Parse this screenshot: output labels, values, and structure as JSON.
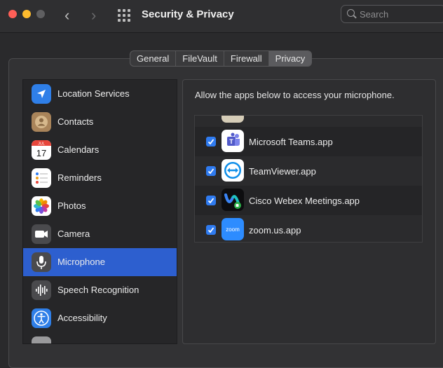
{
  "window": {
    "title": "Security & Privacy"
  },
  "search": {
    "placeholder": "Search"
  },
  "tabs": [
    {
      "label": "General"
    },
    {
      "label": "FileVault"
    },
    {
      "label": "Firewall"
    },
    {
      "label": "Privacy",
      "active": true
    }
  ],
  "sidebar": {
    "items": [
      {
        "label": "Location Services",
        "icon": "location-arrow-icon"
      },
      {
        "label": "Contacts",
        "icon": "contacts-icon"
      },
      {
        "label": "Calendars",
        "icon": "calendar-icon",
        "icon_month": "JUL",
        "icon_day": "17"
      },
      {
        "label": "Reminders",
        "icon": "reminders-icon"
      },
      {
        "label": "Photos",
        "icon": "photos-icon"
      },
      {
        "label": "Camera",
        "icon": "camera-icon"
      },
      {
        "label": "Microphone",
        "icon": "microphone-icon",
        "selected": true
      },
      {
        "label": "Speech Recognition",
        "icon": "speech-waveform-icon"
      },
      {
        "label": "Accessibility",
        "icon": "accessibility-icon"
      }
    ]
  },
  "main": {
    "instruction": "Allow the apps below to access your microphone.",
    "apps": [
      {
        "label": "Microsoft Teams.app",
        "icon": "teams-icon",
        "checked": true
      },
      {
        "label": "TeamViewer.app",
        "icon": "teamviewer-icon",
        "checked": true
      },
      {
        "label": "Cisco Webex Meetings.app",
        "icon": "webex-icon",
        "checked": true
      },
      {
        "label": "zoom.us.app",
        "icon": "zoom-icon",
        "icon_text": "zoom",
        "checked": true
      }
    ]
  },
  "colors": {
    "accent": "#2d5fcf",
    "checkbox": "#2f7bf0",
    "close": "#ff5f57",
    "minimize": "#febc2e",
    "disabled": "#5f5f61"
  }
}
